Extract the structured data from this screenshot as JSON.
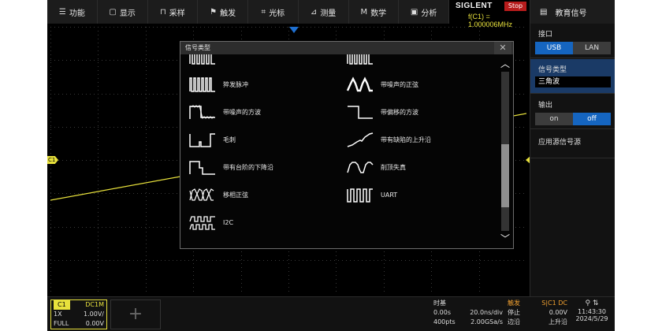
{
  "menu": [
    {
      "icon": "☰",
      "label": "功能"
    },
    {
      "icon": "▢",
      "label": "显示"
    },
    {
      "icon": "⊓",
      "label": "采样"
    },
    {
      "icon": "⚑",
      "label": "触发"
    },
    {
      "icon": "⌗",
      "label": "光标"
    },
    {
      "icon": "⊿",
      "label": "测量"
    },
    {
      "icon": "M",
      "label": "数学"
    },
    {
      "icon": "▣",
      "label": "分析"
    }
  ],
  "brand": "SIGLENT",
  "run_state": "Stop",
  "frequency": "f(C1) = 1.000006MHz",
  "right_panel": {
    "title": "教育信号",
    "interface_label": "接口",
    "interface_options": [
      "USB",
      "LAN"
    ],
    "interface_selected": "USB",
    "signal_type_label": "信号类型",
    "signal_type_value": "三角波",
    "output_label": "输出",
    "output_options": [
      "on",
      "off"
    ],
    "output_selected": "off",
    "apply_label": "应用源信号源"
  },
  "dialog": {
    "title": "信号类型",
    "close": "✕",
    "items": [
      {
        "label": "",
        "icon": "burst-icon"
      },
      {
        "label": "",
        "icon": "pulse-train-icon"
      },
      {
        "label": "猝发脉冲",
        "icon": "burst-pulse-icon"
      },
      {
        "label": "带噪声的正弦",
        "icon": "noisy-sine-icon"
      },
      {
        "label": "带噪声的方波",
        "icon": "noisy-square-icon"
      },
      {
        "label": "带偏移的方波",
        "icon": "offset-square-icon"
      },
      {
        "label": "毛刺",
        "icon": "glitch-icon"
      },
      {
        "label": "带有缺陷的上升沿",
        "icon": "defect-rising-edge-icon"
      },
      {
        "label": "带有台阶的下降沿",
        "icon": "step-falling-edge-icon"
      },
      {
        "label": "削顶失真",
        "icon": "clipped-sine-icon"
      },
      {
        "label": "移相正弦",
        "icon": "phase-shift-sine-icon"
      },
      {
        "label": "UART",
        "icon": "uart-icon"
      },
      {
        "label": "I2C",
        "icon": "i2c-icon"
      }
    ],
    "scroll_up": "︿",
    "scroll_down": "﹀"
  },
  "channel": {
    "tag": "C1",
    "coupling": "DC1M",
    "probe": "1X",
    "scale": "1.00V/",
    "bandwidth": "FULL",
    "offset": "0.00V",
    "marker": "C1"
  },
  "add_channel": "+",
  "timebase": {
    "title": "时基",
    "delay": "0.00s",
    "scale": "20.0ns/div",
    "points": "400pts",
    "rate": "2.00GSa/s"
  },
  "trigger": {
    "title": "触发",
    "source": "S|C1 DC",
    "state": "停止",
    "level": "0.00V",
    "type": "边沿",
    "slope": "上升沿"
  },
  "clock": {
    "time": "11:43:30",
    "date": "2024/5/29"
  },
  "colors": {
    "channel1": "#e8e13c",
    "accent_blue": "#1565c0",
    "stop_red": "#b71c1c",
    "grid": "#3a3a3a"
  }
}
